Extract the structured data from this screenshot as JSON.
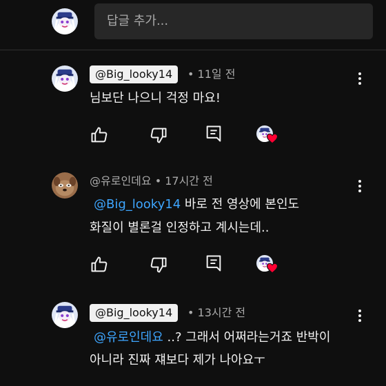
{
  "reply_input": {
    "placeholder": "답글 추가..."
  },
  "colors": {
    "background": "#0f0f0f",
    "mention": "#3ea6ff",
    "heart": "#ff0033",
    "chip": "#f1f1f1"
  },
  "icons": {
    "like": "thumb-up-icon",
    "dislike": "thumb-down-icon",
    "reply": "comment-reply-icon",
    "hearted": "creator-heart-icon",
    "more": "more-vert-icon"
  },
  "comments": [
    {
      "author": "@Big_looky14",
      "author_is_creator": true,
      "time": "• 11일 전",
      "lines": [
        {
          "mention": "",
          "text": "님보단 나으니 걱정 마요!"
        }
      ]
    },
    {
      "author": "@유로인데요",
      "author_is_creator": false,
      "time": "• 17시간 전",
      "lines": [
        {
          "mention": "@Big_looky14",
          "text": " 바로 전 영상에 본인도"
        },
        {
          "mention": "",
          "text": "화질이 별론걸 인정하고 계시는데.."
        }
      ]
    },
    {
      "author": "@Big_looky14",
      "author_is_creator": true,
      "time": "• 13시간 전",
      "lines": [
        {
          "mention": "@유로인데요",
          "text": " ..? 그래서 어쩌라는거죠 반박이"
        },
        {
          "mention": "",
          "text": "아니라 진짜 쟤보다 제가 나아요ㅜ"
        }
      ]
    }
  ]
}
